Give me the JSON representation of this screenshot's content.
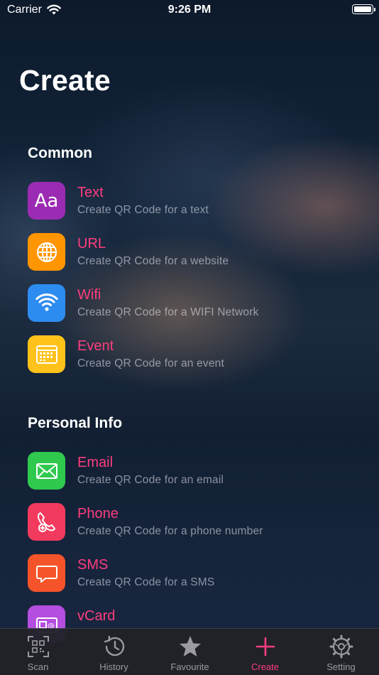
{
  "status_bar": {
    "carrier": "Carrier",
    "time": "9:26 PM"
  },
  "page_title": "Create",
  "sections": [
    {
      "title": "Common",
      "items": [
        {
          "title": "Text",
          "subtitle": "Create QR Code for a text",
          "icon": "text-aa-icon",
          "color": "#9b2bb3"
        },
        {
          "title": "URL",
          "subtitle": "Create QR Code for a website",
          "icon": "globe-icon",
          "color": "#ff9500"
        },
        {
          "title": "Wifi",
          "subtitle": "Create QR Code for a WIFI Network",
          "icon": "wifi-icon",
          "color": "#2d8cf0"
        },
        {
          "title": "Event",
          "subtitle": "Create QR Code for an event",
          "icon": "calendar-icon",
          "color": "#ffc21a"
        }
      ]
    },
    {
      "title": "Personal Info",
      "items": [
        {
          "title": "Email",
          "subtitle": "Create QR Code for an email",
          "icon": "envelope-icon",
          "color": "#2fc94e"
        },
        {
          "title": "Phone",
          "subtitle": "Create QR Code for a phone number",
          "icon": "phone-icon",
          "color": "#f23a5e"
        },
        {
          "title": "SMS",
          "subtitle": "Create QR Code for a SMS",
          "icon": "message-icon",
          "color": "#f5542a"
        },
        {
          "title": "vCard",
          "subtitle": "",
          "icon": "contact-card-icon",
          "color": "#b44ee0"
        }
      ]
    }
  ],
  "tab_bar": {
    "tabs": [
      {
        "label": "Scan",
        "icon": "qr-scan-icon",
        "active": false
      },
      {
        "label": "History",
        "icon": "history-clock-icon",
        "active": false
      },
      {
        "label": "Favourite",
        "icon": "star-icon",
        "active": false
      },
      {
        "label": "Create",
        "icon": "plus-icon",
        "active": true
      },
      {
        "label": "Setting",
        "icon": "gear-icon",
        "active": false
      }
    ],
    "active_color": "#ff3d7f",
    "inactive_color": "#9a9aa0"
  }
}
